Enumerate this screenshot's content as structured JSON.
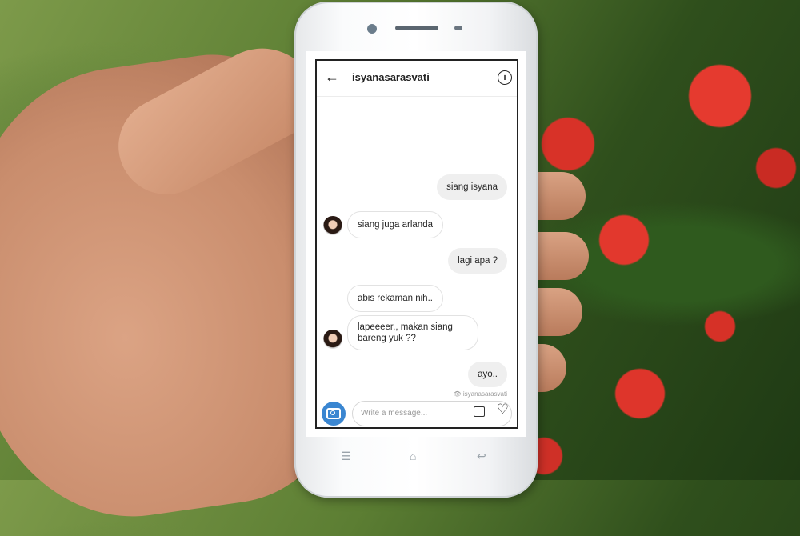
{
  "chat": {
    "username": "isyanasarasvati",
    "messages": [
      {
        "dir": "out",
        "text": "siang isyana"
      },
      {
        "dir": "in",
        "text": "siang juga arlanda"
      },
      {
        "dir": "out",
        "text": "lagi apa ?"
      },
      {
        "dir": "in",
        "text": "abis rekaman nih.."
      },
      {
        "dir": "in",
        "text": "lapeeeer,, makan siang bareng yuk ??"
      },
      {
        "dir": "out",
        "text": "ayo.."
      }
    ],
    "seen_by": "isyanasarasvati",
    "composer_placeholder": "Write a message..."
  },
  "icons": {
    "back": "arrow-left-icon",
    "info": "info-icon",
    "camera": "camera-icon",
    "gallery": "image-icon",
    "like": "heart-icon"
  },
  "colors": {
    "camera_button": "#3a86d1",
    "bubble_out": "#efefef"
  }
}
